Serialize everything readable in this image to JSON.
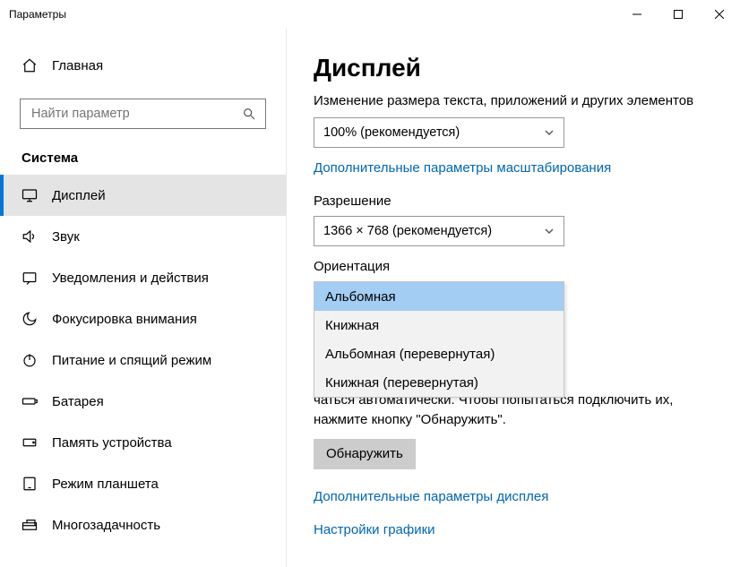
{
  "window": {
    "title": "Параметры"
  },
  "sidebar": {
    "home": "Главная",
    "search_placeholder": "Найти параметр",
    "section": "Система",
    "items": [
      {
        "icon": "display",
        "label": "Дисплей",
        "active": true
      },
      {
        "icon": "sound",
        "label": "Звук"
      },
      {
        "icon": "notifications",
        "label": "Уведомления и действия"
      },
      {
        "icon": "focus",
        "label": "Фокусировка внимания"
      },
      {
        "icon": "power",
        "label": "Питание и спящий режим"
      },
      {
        "icon": "battery",
        "label": "Батарея"
      },
      {
        "icon": "storage",
        "label": "Память устройства"
      },
      {
        "icon": "tablet",
        "label": "Режим планшета"
      },
      {
        "icon": "multitask",
        "label": "Многозадачность"
      }
    ]
  },
  "content": {
    "heading": "Дисплей",
    "scale_label": "Изменение размера текста, приложений и других элементов",
    "scale_value": "100% (рекомендуется)",
    "scale_link": "Дополнительные параметры масштабирования",
    "resolution_label": "Разрешение",
    "resolution_value": "1366 × 768 (рекомендуется)",
    "orientation_label": "Ориентация",
    "orientation_options": [
      "Альбомная",
      "Книжная",
      "Альбомная (перевернутая)",
      "Книжная (перевернутая)"
    ],
    "orientation_selected": "Альбомная",
    "multi_text_tail": "чаться автоматически. Чтобы попытаться подключить их, нажмите кнопку \"Обнаружить\".",
    "detect_button": "Обнаружить",
    "advanced_link": "Дополнительные параметры дисплея",
    "graphics_link": "Настройки графики"
  }
}
